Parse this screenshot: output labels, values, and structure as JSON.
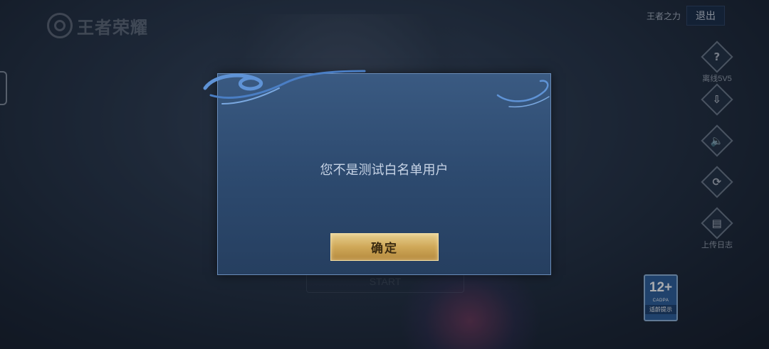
{
  "logo": {
    "text": "王者荣耀"
  },
  "header": {
    "power_label": "王者之力",
    "exit_label": "退出"
  },
  "right_bar": [
    {
      "icon": "question-icon",
      "glyph": "?",
      "label": "离线5V5"
    },
    {
      "icon": "download-icon",
      "glyph": "⇩",
      "label": ""
    },
    {
      "icon": "speaker-icon",
      "glyph": "🔈",
      "label": ""
    },
    {
      "icon": "phone-rotate-icon",
      "glyph": "⟳",
      "label": ""
    },
    {
      "icon": "clipboard-icon",
      "glyph": "▤",
      "label": "上传日志"
    }
  ],
  "background": {
    "start_button_ghost": "START"
  },
  "dialog": {
    "message": "您不是测试白名单用户",
    "confirm_label": "确定"
  },
  "rating_badge": {
    "age": "12+",
    "org": "CADPA",
    "tip": "适龄提示"
  },
  "colors": {
    "dialog_bg": "#2d4a6f",
    "button_gold": "#cfa858",
    "exit_bg": "#1a2b45"
  }
}
